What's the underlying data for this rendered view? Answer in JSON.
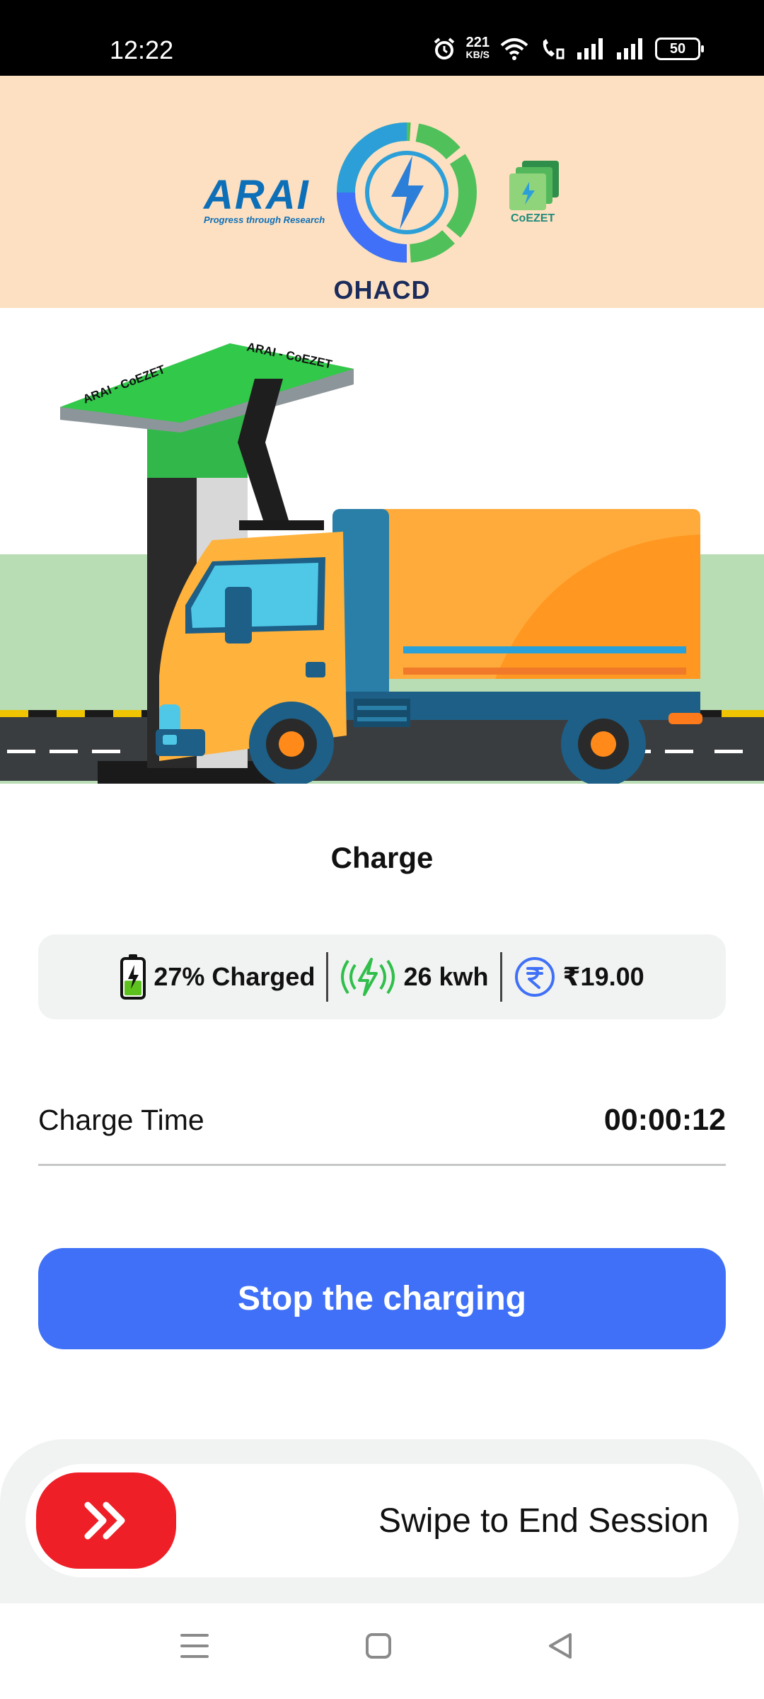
{
  "status_bar": {
    "time": "12:22",
    "net_speed": "221",
    "net_unit": "KB/S",
    "battery": "50"
  },
  "header": {
    "brand": "ARAI",
    "brand_tagline": "Progress through Research",
    "app_name": "OHACD",
    "partner": "CoEZET"
  },
  "illustration": {
    "canopy_text_left": "ARAI - CoEZET",
    "canopy_text_right": "ARAI - CoEZET"
  },
  "charge": {
    "title": "Charge",
    "percent_charged": "27% Charged",
    "battery_level": 0.27,
    "energy": "26 kwh",
    "cost": "₹19.00",
    "time_label": "Charge Time",
    "time_value": "00:00:12",
    "stop_label": "Stop the charging"
  },
  "swipe": {
    "label": "Swipe to End Session"
  },
  "colors": {
    "header_bg": "#fde0c1",
    "primary": "#3f70f7",
    "danger": "#ef1f28",
    "energy_green": "#2fbf4a"
  },
  "icons": {
    "battery": "battery-charging-icon",
    "energy": "energy-bolt-icon",
    "cost": "rupee-icon",
    "swipe": "double-chevron-right-icon"
  }
}
